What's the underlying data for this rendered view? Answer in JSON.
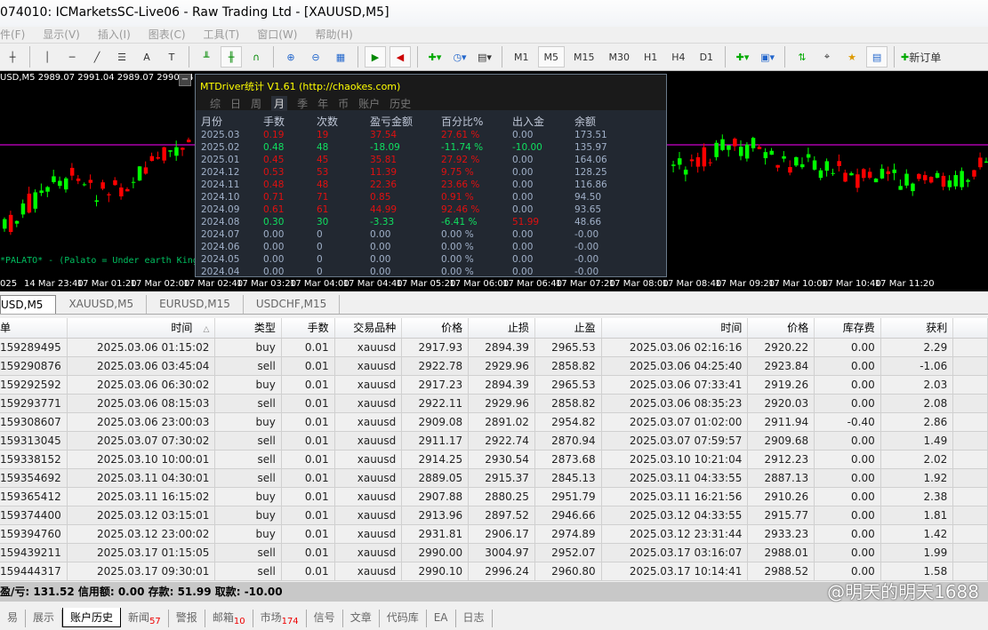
{
  "window": {
    "title": "074010: ICMarketsSC-Live06 - Raw Trading Ltd - [XAUUSD,M5]"
  },
  "menu": [
    "件(F)",
    "显示(V)",
    "插入(I)",
    "图表(C)",
    "工具(T)",
    "窗口(W)",
    "帮助(H)"
  ],
  "toolbar": {
    "timeframes": [
      "M1",
      "M5",
      "M15",
      "M30",
      "H1",
      "H4",
      "D1"
    ],
    "active_timeframe": "M5",
    "new_order": "新订单",
    "text_tool": "A"
  },
  "chart": {
    "info": "USD,M5  2989.07 2991.04 2989.07 2990.84",
    "minimize": "−",
    "palato": "*PALATO* - (Palato = Under earth King",
    "colors": {
      "bull": "#00ff00",
      "bear": "#ff0000",
      "line": "#ff00ff"
    },
    "time_labels": [
      "025",
      "14 Mar 23:40",
      "17 Mar 01:20",
      "17 Mar 02:00",
      "17 Mar 02:40",
      "17 Mar 03:20",
      "17 Mar 04:00",
      "17 Mar 04:40",
      "17 Mar 05:20",
      "17 Mar 06:00",
      "17 Mar 06:40",
      "17 Mar 07:20",
      "17 Mar 08:00",
      "17 Mar 08:40",
      "17 Mar 09:20",
      "17 Mar 10:00",
      "17 Mar 10:40",
      "17 Mar 11:20"
    ]
  },
  "panel": {
    "title": "MTDriver统计 V1.61  (http://chaokes.com)",
    "tabs": [
      "综",
      "日",
      "周",
      "月",
      "季",
      "年",
      "币",
      "账户",
      "历史"
    ],
    "active_tab": "月",
    "headers": [
      "月份",
      "手数",
      "次数",
      "盈亏金额",
      "百分比%",
      "出入金",
      "余额"
    ],
    "rows": [
      [
        "2025.03",
        "0.19",
        "19",
        "37.54",
        "27.61 %",
        "0.00",
        "173.51",
        "r"
      ],
      [
        "2025.02",
        "0.48",
        "48",
        "-18.09",
        "-11.74 %",
        "-10.00",
        "135.97",
        "g"
      ],
      [
        "2025.01",
        "0.45",
        "45",
        "35.81",
        "27.92 %",
        "0.00",
        "164.06",
        "r"
      ],
      [
        "2024.12",
        "0.53",
        "53",
        "11.39",
        "9.75 %",
        "0.00",
        "128.25",
        "r"
      ],
      [
        "2024.11",
        "0.48",
        "48",
        "22.36",
        "23.66 %",
        "0.00",
        "116.86",
        "r"
      ],
      [
        "2024.10",
        "0.71",
        "71",
        "0.85",
        "0.91 %",
        "0.00",
        "94.50",
        "r"
      ],
      [
        "2024.09",
        "0.61",
        "61",
        "44.99",
        "92.46 %",
        "0.00",
        "93.65",
        "r"
      ],
      [
        "2024.08",
        "0.30",
        "30",
        "-3.33",
        "-6.41 %",
        "51.99",
        "48.66",
        "g"
      ],
      [
        "2024.07",
        "0.00",
        "0",
        "0.00",
        "0.00 %",
        "0.00",
        "-0.00",
        ""
      ],
      [
        "2024.06",
        "0.00",
        "0",
        "0.00",
        "0.00 %",
        "0.00",
        "-0.00",
        ""
      ],
      [
        "2024.05",
        "0.00",
        "0",
        "0.00",
        "0.00 %",
        "0.00",
        "-0.00",
        ""
      ],
      [
        "2024.04",
        "0.00",
        "0",
        "0.00",
        "0.00 %",
        "0.00",
        "-0.00",
        ""
      ]
    ]
  },
  "chart_tabs": [
    "USD,M5",
    "XAUUSD,M5",
    "EURUSD,M15",
    "USDCHF,M15"
  ],
  "history": {
    "headers": [
      "单",
      "时间",
      "类型",
      "手数",
      "交易品种",
      "价格",
      "止损",
      "止盈",
      "时间",
      "价格",
      "库存费",
      "获利",
      ""
    ],
    "sort_indicator": "△",
    "rows": [
      [
        "159289495",
        "2025.03.06 01:15:02",
        "buy",
        "0.01",
        "xauusd",
        "2917.93",
        "2894.39",
        "2965.53",
        "2025.03.06 02:16:16",
        "2920.22",
        "0.00",
        "2.29"
      ],
      [
        "159290876",
        "2025.03.06 03:45:04",
        "sell",
        "0.01",
        "xauusd",
        "2922.78",
        "2929.96",
        "2858.82",
        "2025.03.06 04:25:40",
        "2923.84",
        "0.00",
        "-1.06"
      ],
      [
        "159292592",
        "2025.03.06 06:30:02",
        "buy",
        "0.01",
        "xauusd",
        "2917.23",
        "2894.39",
        "2965.53",
        "2025.03.06 07:33:41",
        "2919.26",
        "0.00",
        "2.03"
      ],
      [
        "159293771",
        "2025.03.06 08:15:03",
        "sell",
        "0.01",
        "xauusd",
        "2922.11",
        "2929.96",
        "2858.82",
        "2025.03.06 08:35:23",
        "2920.03",
        "0.00",
        "2.08"
      ],
      [
        "159308607",
        "2025.03.06 23:00:03",
        "buy",
        "0.01",
        "xauusd",
        "2909.08",
        "2891.02",
        "2954.82",
        "2025.03.07 01:02:00",
        "2911.94",
        "-0.40",
        "2.86"
      ],
      [
        "159313045",
        "2025.03.07 07:30:02",
        "sell",
        "0.01",
        "xauusd",
        "2911.17",
        "2922.74",
        "2870.94",
        "2025.03.07 07:59:57",
        "2909.68",
        "0.00",
        "1.49"
      ],
      [
        "159338152",
        "2025.03.10 10:00:01",
        "sell",
        "0.01",
        "xauusd",
        "2914.25",
        "2930.54",
        "2873.68",
        "2025.03.10 10:21:04",
        "2912.23",
        "0.00",
        "2.02"
      ],
      [
        "159354692",
        "2025.03.11 04:30:01",
        "sell",
        "0.01",
        "xauusd",
        "2889.05",
        "2915.37",
        "2845.13",
        "2025.03.11 04:33:55",
        "2887.13",
        "0.00",
        "1.92"
      ],
      [
        "159365412",
        "2025.03.11 16:15:02",
        "buy",
        "0.01",
        "xauusd",
        "2907.88",
        "2880.25",
        "2951.79",
        "2025.03.11 16:21:56",
        "2910.26",
        "0.00",
        "2.38"
      ],
      [
        "159374400",
        "2025.03.12 03:15:01",
        "buy",
        "0.01",
        "xauusd",
        "2913.96",
        "2897.52",
        "2946.66",
        "2025.03.12 04:33:55",
        "2915.77",
        "0.00",
        "1.81"
      ],
      [
        "159394760",
        "2025.03.12 23:00:02",
        "buy",
        "0.01",
        "xauusd",
        "2931.81",
        "2906.17",
        "2974.89",
        "2025.03.12 23:31:44",
        "2933.23",
        "0.00",
        "1.42"
      ],
      [
        "159439211",
        "2025.03.17 01:15:05",
        "sell",
        "0.01",
        "xauusd",
        "2990.00",
        "3004.97",
        "2952.07",
        "2025.03.17 03:16:07",
        "2988.01",
        "0.00",
        "1.99"
      ],
      [
        "159444317",
        "2025.03.17 09:30:01",
        "sell",
        "0.01",
        "xauusd",
        "2990.10",
        "2996.24",
        "2960.80",
        "2025.03.17 10:14:41",
        "2988.52",
        "0.00",
        "1.58"
      ]
    ]
  },
  "status": "盈/亏: 131.52  信用额: 0.00  存款: 51.99  取款: -10.00",
  "bottom_tabs": [
    {
      "label": "易"
    },
    {
      "label": "展示"
    },
    {
      "label": "账户历史",
      "active": true
    },
    {
      "label": "新闻",
      "badge": "57"
    },
    {
      "label": "警报"
    },
    {
      "label": "邮箱",
      "badge": "10"
    },
    {
      "label": "市场",
      "badge": "174"
    },
    {
      "label": "信号"
    },
    {
      "label": "文章"
    },
    {
      "label": "代码库"
    },
    {
      "label": "EA"
    },
    {
      "label": "日志"
    }
  ],
  "watermark": "@明天的明天1688"
}
